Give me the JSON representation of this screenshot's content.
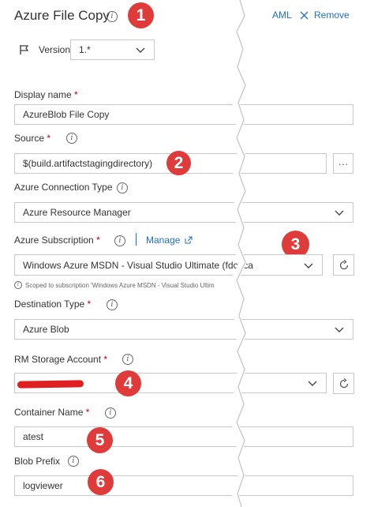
{
  "header": {
    "title": "Azure File Copy",
    "yaml_label": "AML",
    "remove_label": "Remove"
  },
  "version": {
    "label": "Version",
    "value": "1.*"
  },
  "fields": {
    "display_name": {
      "label": "Display name",
      "value": "AzureBlob File Copy"
    },
    "source": {
      "label": "Source",
      "value": "$(build.artifactstagingdirectory)",
      "more": "···"
    },
    "connection_type": {
      "label": "Azure Connection Type",
      "value": "Azure Resource Manager"
    },
    "subscription": {
      "label": "Azure Subscription",
      "manage": "Manage",
      "value": "Windows Azure MSDN - Visual Studio Ultimate (fdc2ca",
      "note": "Scoped to subscription 'Windows Azure MSDN - Visual Studio Ultim"
    },
    "destination_type": {
      "label": "Destination Type",
      "value": "Azure Blob"
    },
    "storage_account": {
      "label": "RM Storage Account",
      "value": ""
    },
    "container_name": {
      "label": "Container Name",
      "value": "atest"
    },
    "blob_prefix": {
      "label": "Blob Prefix",
      "value": "logviewer"
    }
  },
  "badges": [
    "1",
    "2",
    "3",
    "4",
    "5",
    "6"
  ],
  "required_mark": "*",
  "colors": {
    "accent": "#1f6fc5",
    "badge": "#e03b3b",
    "required": "#c00000",
    "redaction": "#e02020"
  }
}
